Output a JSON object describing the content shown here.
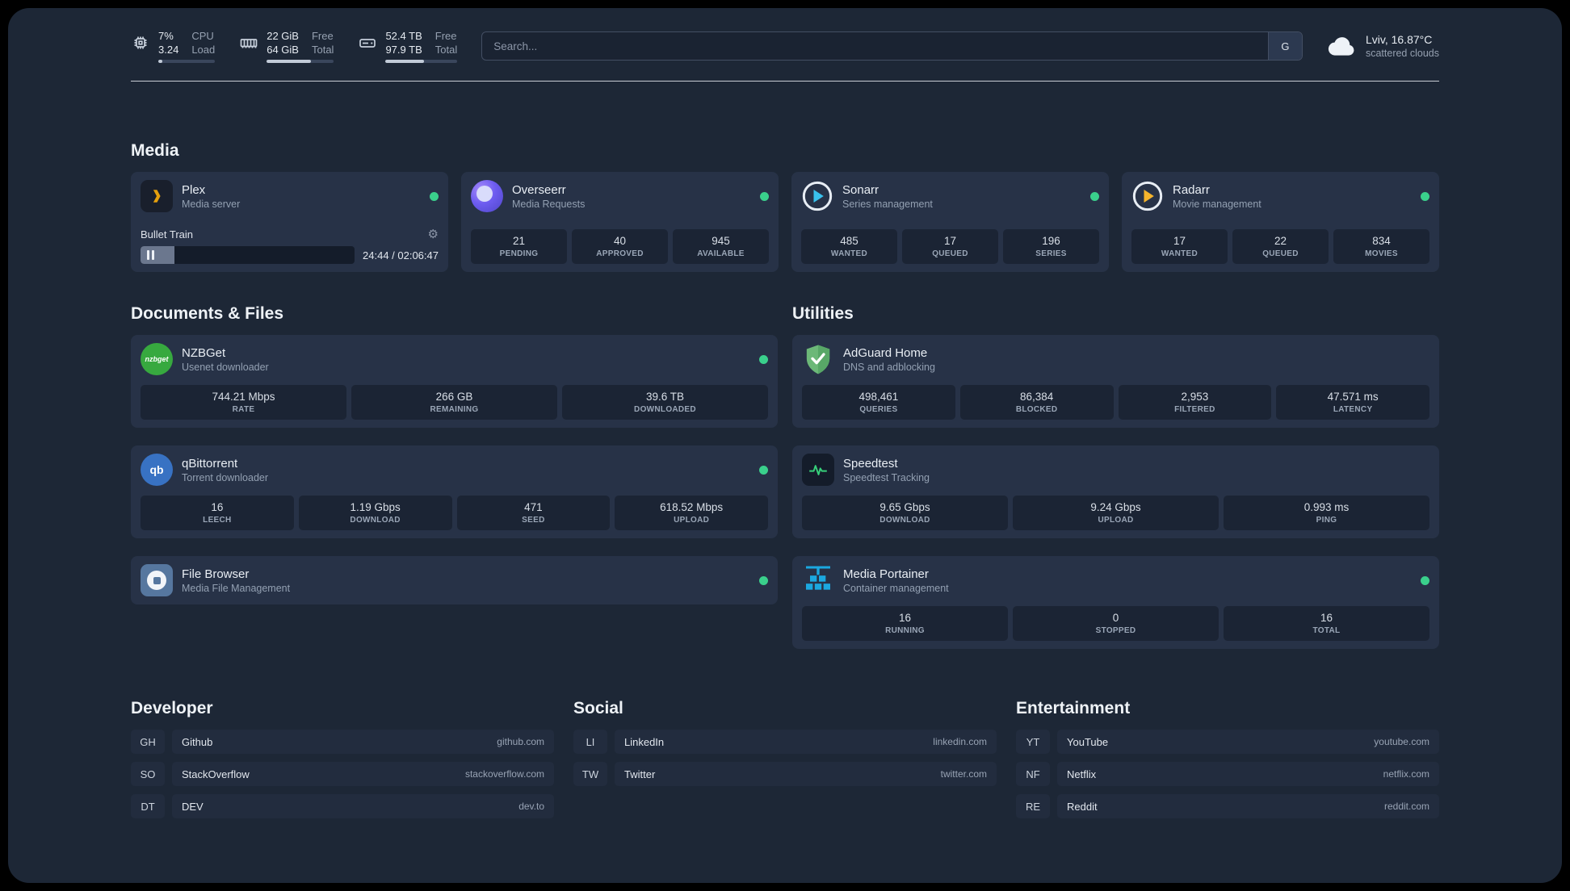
{
  "colors": {
    "status_ok": "#3ad08c",
    "plex_accent": "#e5a00d"
  },
  "topbar": {
    "cpu": {
      "value1": "7%",
      "label1": "CPU",
      "value2": "3.24",
      "label2": "Load",
      "bar_percent": 7
    },
    "memory": {
      "value1": "22 GiB",
      "label1": "Free",
      "value2": "64 GiB",
      "label2": "Total",
      "bar_percent": 66
    },
    "disk": {
      "value1": "52.4 TB",
      "label1": "Free",
      "value2": "97.9 TB",
      "label2": "Total",
      "bar_percent": 54
    },
    "search": {
      "placeholder": "Search...",
      "button_label": "G"
    },
    "weather": {
      "location": "Lviv, 16.87°C",
      "condition": "scattered clouds"
    }
  },
  "media": {
    "title": "Media",
    "cards": [
      {
        "name": "Plex",
        "desc": "Media server",
        "player": {
          "track": "Bullet Train",
          "time": "24:44 / 02:06:47",
          "progress_percent": 16
        }
      },
      {
        "name": "Overseerr",
        "desc": "Media Requests",
        "stats": [
          {
            "value": "21",
            "label": "PENDING"
          },
          {
            "value": "40",
            "label": "APPROVED"
          },
          {
            "value": "945",
            "label": "AVAILABLE"
          }
        ]
      },
      {
        "name": "Sonarr",
        "desc": "Series management",
        "stats": [
          {
            "value": "485",
            "label": "WANTED"
          },
          {
            "value": "17",
            "label": "QUEUED"
          },
          {
            "value": "196",
            "label": "SERIES"
          }
        ]
      },
      {
        "name": "Radarr",
        "desc": "Movie management",
        "stats": [
          {
            "value": "17",
            "label": "WANTED"
          },
          {
            "value": "22",
            "label": "QUEUED"
          },
          {
            "value": "834",
            "label": "MOVIES"
          }
        ]
      }
    ]
  },
  "documents": {
    "title": "Documents & Files",
    "cards": [
      {
        "name": "NZBGet",
        "desc": "Usenet downloader",
        "icon_text": "nzbget",
        "stats": [
          {
            "value": "744.21 Mbps",
            "label": "RATE"
          },
          {
            "value": "266 GB",
            "label": "REMAINING"
          },
          {
            "value": "39.6 TB",
            "label": "DOWNLOADED"
          }
        ]
      },
      {
        "name": "qBittorrent",
        "desc": "Torrent downloader",
        "icon_text": "qb",
        "stats": [
          {
            "value": "16",
            "label": "LEECH"
          },
          {
            "value": "1.19 Gbps",
            "label": "DOWNLOAD"
          },
          {
            "value": "471",
            "label": "SEED"
          },
          {
            "value": "618.52 Mbps",
            "label": "UPLOAD"
          }
        ]
      },
      {
        "name": "File Browser",
        "desc": "Media File Management"
      }
    ]
  },
  "utilities": {
    "title": "Utilities",
    "cards": [
      {
        "name": "AdGuard Home",
        "desc": "DNS and adblocking",
        "stats": [
          {
            "value": "498,461",
            "label": "QUERIES"
          },
          {
            "value": "86,384",
            "label": "BLOCKED"
          },
          {
            "value": "2,953",
            "label": "FILTERED"
          },
          {
            "value": "47.571 ms",
            "label": "LATENCY"
          }
        ]
      },
      {
        "name": "Speedtest",
        "desc": "Speedtest Tracking",
        "stats": [
          {
            "value": "9.65 Gbps",
            "label": "DOWNLOAD"
          },
          {
            "value": "9.24 Gbps",
            "label": "UPLOAD"
          },
          {
            "value": "0.993 ms",
            "label": "PING"
          }
        ]
      },
      {
        "name": "Media Portainer",
        "desc": "Container management",
        "stats": [
          {
            "value": "16",
            "label": "RUNNING"
          },
          {
            "value": "0",
            "label": "STOPPED"
          },
          {
            "value": "16",
            "label": "TOTAL"
          }
        ]
      }
    ]
  },
  "bookmarks": [
    {
      "title": "Developer",
      "items": [
        {
          "abbr": "GH",
          "name": "Github",
          "url": "github.com"
        },
        {
          "abbr": "SO",
          "name": "StackOverflow",
          "url": "stackoverflow.com"
        },
        {
          "abbr": "DT",
          "name": "DEV",
          "url": "dev.to"
        }
      ]
    },
    {
      "title": "Social",
      "items": [
        {
          "abbr": "LI",
          "name": "LinkedIn",
          "url": "linkedin.com"
        },
        {
          "abbr": "TW",
          "name": "Twitter",
          "url": "twitter.com"
        }
      ]
    },
    {
      "title": "Entertainment",
      "items": [
        {
          "abbr": "YT",
          "name": "YouTube",
          "url": "youtube.com"
        },
        {
          "abbr": "NF",
          "name": "Netflix",
          "url": "netflix.com"
        },
        {
          "abbr": "RE",
          "name": "Reddit",
          "url": "reddit.com"
        }
      ]
    }
  ]
}
